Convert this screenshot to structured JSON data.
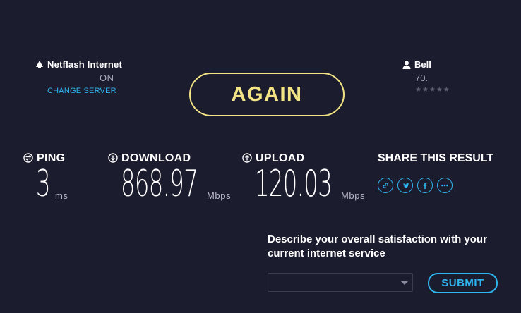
{
  "server": {
    "name": "Netflash Internet",
    "location": "ON",
    "change_label": "CHANGE SERVER"
  },
  "isp": {
    "name": "Bell",
    "ip": "70.",
    "stars": "★★★★★",
    "rating_stars_filled": 0,
    "rating_stars_total": 5
  },
  "again_label": "AGAIN",
  "metrics": {
    "ping": {
      "label": "PING",
      "value": "3",
      "unit": "ms"
    },
    "download": {
      "label": "DOWNLOAD",
      "value": "868.97",
      "unit": "Mbps"
    },
    "upload": {
      "label": "UPLOAD",
      "value": "120.03",
      "unit": "Mbps"
    }
  },
  "share": {
    "label": "SHARE THIS RESULT",
    "icons": [
      "link-icon",
      "twitter-icon",
      "facebook-icon",
      "more-icon"
    ]
  },
  "feedback": {
    "question": "Describe your overall satisfaction with your current internet service",
    "selected_value": "",
    "submit_label": "SUBMIT"
  },
  "colors": {
    "background": "#1c1c2f",
    "accent_yellow": "#f3e585",
    "accent_blue": "#2fb5f0"
  }
}
